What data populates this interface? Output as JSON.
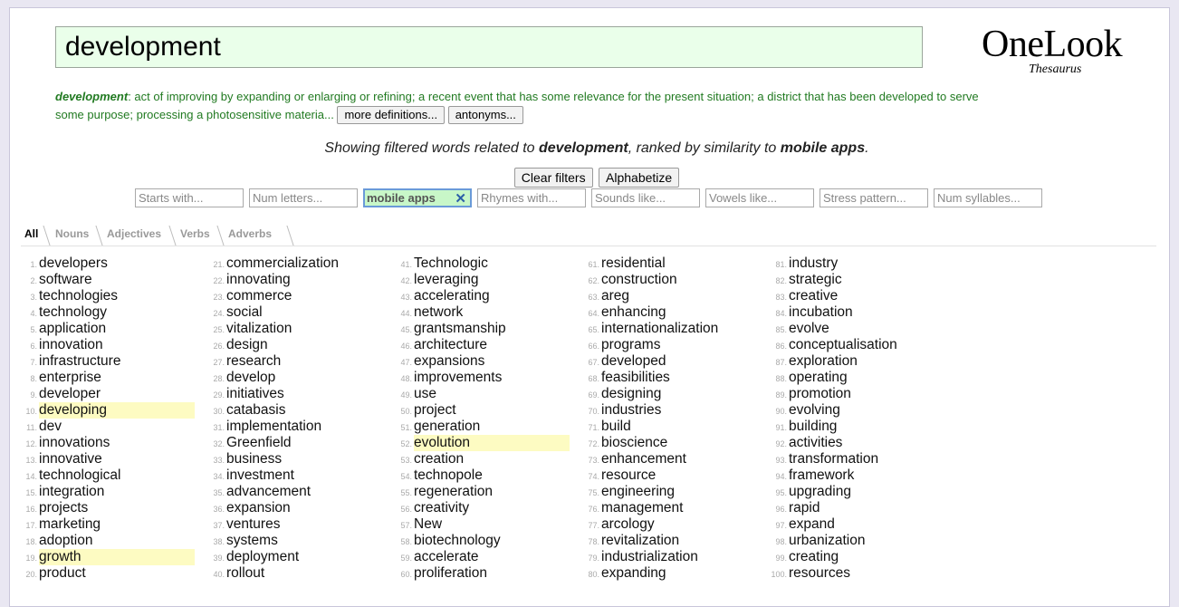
{
  "search": {
    "query": "development"
  },
  "logo": {
    "main": "OneLook",
    "sub": "Thesaurus"
  },
  "definition": {
    "term": "development",
    "text": ": act of improving by expanding or enlarging or refining; a recent event that has some relevance for the present situation; a district that has been developed to serve some purpose; processing a photosensitive materia...",
    "more_definitions_label": "more definitions...",
    "antonyms_label": "antonyms..."
  },
  "summary": {
    "prefix": "Showing filtered words related to ",
    "word": "development",
    "middle": ", ranked by similarity to ",
    "topic": "mobile apps",
    "suffix": "."
  },
  "buttons": {
    "clear_filters": "Clear filters",
    "alphabetize": "Alphabetize"
  },
  "filters": [
    {
      "placeholder": "Starts with..."
    },
    {
      "placeholder": "Num letters..."
    },
    {
      "value": "mobile apps",
      "clear_icon": "close-icon"
    },
    {
      "placeholder": "Rhymes with..."
    },
    {
      "placeholder": "Sounds like..."
    },
    {
      "placeholder": "Vowels like..."
    },
    {
      "placeholder": "Stress pattern..."
    },
    {
      "placeholder": "Num syllables..."
    }
  ],
  "tabs": [
    "All",
    "Nouns",
    "Adjectives",
    "Verbs",
    "Adverbs"
  ],
  "colors": {
    "highlight": "#fdfbc2",
    "definition": "#217a21",
    "search_bg": "#eaffea"
  },
  "results": [
    {
      "n": "1.",
      "w": "developers"
    },
    {
      "n": "2.",
      "w": "software"
    },
    {
      "n": "3.",
      "w": "technologies"
    },
    {
      "n": "4.",
      "w": "technology"
    },
    {
      "n": "5.",
      "w": "application"
    },
    {
      "n": "6.",
      "w": "innovation"
    },
    {
      "n": "7.",
      "w": "infrastructure"
    },
    {
      "n": "8.",
      "w": "enterprise"
    },
    {
      "n": "9.",
      "w": "developer"
    },
    {
      "n": "10.",
      "w": "developing",
      "hl": true
    },
    {
      "n": "11.",
      "w": "dev"
    },
    {
      "n": "12.",
      "w": "innovations"
    },
    {
      "n": "13.",
      "w": "innovative"
    },
    {
      "n": "14.",
      "w": "technological"
    },
    {
      "n": "15.",
      "w": "integration"
    },
    {
      "n": "16.",
      "w": "projects"
    },
    {
      "n": "17.",
      "w": "marketing"
    },
    {
      "n": "18.",
      "w": "adoption"
    },
    {
      "n": "19.",
      "w": "growth",
      "hl": true
    },
    {
      "n": "20.",
      "w": "product"
    },
    {
      "n": "21.",
      "w": "commercialization"
    },
    {
      "n": "22.",
      "w": "innovating"
    },
    {
      "n": "23.",
      "w": "commerce"
    },
    {
      "n": "24.",
      "w": "social"
    },
    {
      "n": "25.",
      "w": "vitalization"
    },
    {
      "n": "26.",
      "w": "design"
    },
    {
      "n": "27.",
      "w": "research"
    },
    {
      "n": "28.",
      "w": "develop"
    },
    {
      "n": "29.",
      "w": "initiatives"
    },
    {
      "n": "30.",
      "w": "catabasis"
    },
    {
      "n": "31.",
      "w": "implementation"
    },
    {
      "n": "32.",
      "w": "Greenfield"
    },
    {
      "n": "33.",
      "w": "business"
    },
    {
      "n": "34.",
      "w": "investment"
    },
    {
      "n": "35.",
      "w": "advancement"
    },
    {
      "n": "36.",
      "w": "expansion"
    },
    {
      "n": "37.",
      "w": "ventures"
    },
    {
      "n": "38.",
      "w": "systems"
    },
    {
      "n": "39.",
      "w": "deployment"
    },
    {
      "n": "40.",
      "w": "rollout"
    },
    {
      "n": "41.",
      "w": "Technologic"
    },
    {
      "n": "42.",
      "w": "leveraging"
    },
    {
      "n": "43.",
      "w": "accelerating"
    },
    {
      "n": "44.",
      "w": "network"
    },
    {
      "n": "45.",
      "w": "grantsmanship"
    },
    {
      "n": "46.",
      "w": "architecture"
    },
    {
      "n": "47.",
      "w": "expansions"
    },
    {
      "n": "48.",
      "w": "improvements"
    },
    {
      "n": "49.",
      "w": "use"
    },
    {
      "n": "50.",
      "w": "project"
    },
    {
      "n": "51.",
      "w": "generation"
    },
    {
      "n": "52.",
      "w": "evolution",
      "hl": true
    },
    {
      "n": "53.",
      "w": "creation"
    },
    {
      "n": "54.",
      "w": "technopole"
    },
    {
      "n": "55.",
      "w": "regeneration"
    },
    {
      "n": "56.",
      "w": "creativity"
    },
    {
      "n": "57.",
      "w": "New"
    },
    {
      "n": "58.",
      "w": "biotechnology"
    },
    {
      "n": "59.",
      "w": "accelerate"
    },
    {
      "n": "60.",
      "w": "proliferation"
    },
    {
      "n": "61.",
      "w": "residential"
    },
    {
      "n": "62.",
      "w": "construction"
    },
    {
      "n": "63.",
      "w": "areg"
    },
    {
      "n": "64.",
      "w": "enhancing"
    },
    {
      "n": "65.",
      "w": "internationalization"
    },
    {
      "n": "66.",
      "w": "programs"
    },
    {
      "n": "67.",
      "w": "developed"
    },
    {
      "n": "68.",
      "w": "feasibilities"
    },
    {
      "n": "69.",
      "w": "designing"
    },
    {
      "n": "70.",
      "w": "industries"
    },
    {
      "n": "71.",
      "w": "build"
    },
    {
      "n": "72.",
      "w": "bioscience"
    },
    {
      "n": "73.",
      "w": "enhancement"
    },
    {
      "n": "74.",
      "w": "resource"
    },
    {
      "n": "75.",
      "w": "engineering"
    },
    {
      "n": "76.",
      "w": "management"
    },
    {
      "n": "77.",
      "w": "arcology"
    },
    {
      "n": "78.",
      "w": "revitalization"
    },
    {
      "n": "79.",
      "w": "industrialization"
    },
    {
      "n": "80.",
      "w": "expanding"
    },
    {
      "n": "81.",
      "w": "industry"
    },
    {
      "n": "82.",
      "w": "strategic"
    },
    {
      "n": "83.",
      "w": "creative"
    },
    {
      "n": "84.",
      "w": "incubation"
    },
    {
      "n": "85.",
      "w": "evolve"
    },
    {
      "n": "86.",
      "w": "conceptualisation"
    },
    {
      "n": "87.",
      "w": "exploration"
    },
    {
      "n": "88.",
      "w": "operating"
    },
    {
      "n": "89.",
      "w": "promotion"
    },
    {
      "n": "90.",
      "w": "evolving"
    },
    {
      "n": "91.",
      "w": "building"
    },
    {
      "n": "92.",
      "w": "activities"
    },
    {
      "n": "93.",
      "w": "transformation"
    },
    {
      "n": "94.",
      "w": "framework"
    },
    {
      "n": "95.",
      "w": "upgrading"
    },
    {
      "n": "96.",
      "w": "rapid"
    },
    {
      "n": "97.",
      "w": "expand"
    },
    {
      "n": "98.",
      "w": "urbanization"
    },
    {
      "n": "99.",
      "w": "creating"
    },
    {
      "n": "100.",
      "w": "resources"
    }
  ]
}
